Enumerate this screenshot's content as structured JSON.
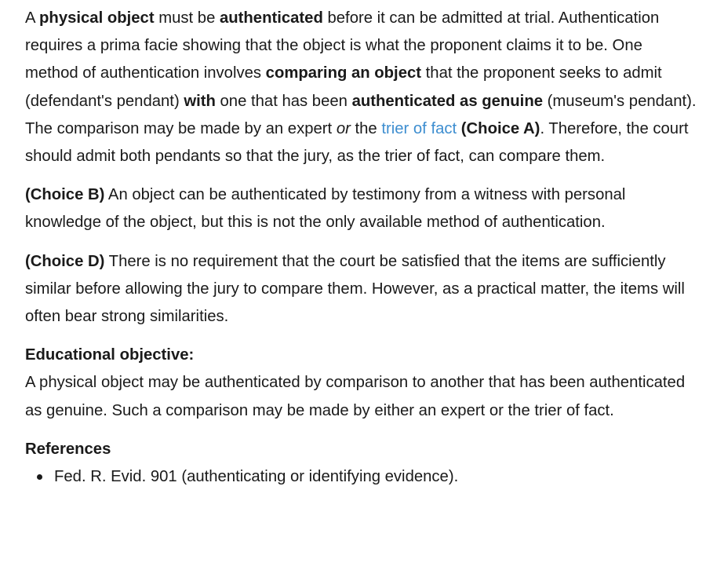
{
  "explanation": {
    "p1": {
      "t1": "A ",
      "b1": "physical object",
      "t2": " must be ",
      "b2": "authenticated",
      "t3": " before it can be admitted at trial.  Authentication requires a prima facie showing that the object is what the proponent claims it to be.  One method of authentication involves ",
      "b3": "comparing an object",
      "t4": " that the proponent seeks to admit (defendant's pendant) ",
      "b4": "with",
      "t5": " one that has been ",
      "b5": "authenticated as genuine",
      "t6": " (museum's pendant).  The comparison may be made by an expert ",
      "i1": "or",
      "t7": " the ",
      "link": "trier of fact",
      "t8": " ",
      "b6": "(Choice A)",
      "t9": ".  Therefore, the court should admit both pendants so that the jury, as the trier of fact, can compare them."
    },
    "p2": {
      "choice": "(Choice B)",
      "text": "  An object can be authenticated by testimony from a witness with personal knowledge of the object, but this is not the only available method of authentication."
    },
    "p3": {
      "choice": "(Choice D)",
      "text": "  There is no requirement that the court be satisfied that the items are sufficiently similar before allowing the jury to compare them.  However, as a practical matter, the items will often bear strong similarities."
    }
  },
  "educational_objective": {
    "heading": "Educational objective:",
    "text": "A physical object may be authenticated by comparison to another that has been authenticated as genuine.  Such a comparison may be made by either an expert or the trier of fact."
  },
  "references": {
    "heading": "References",
    "items": [
      "Fed. R. Evid. 901 (authenticating or identifying evidence)."
    ]
  }
}
